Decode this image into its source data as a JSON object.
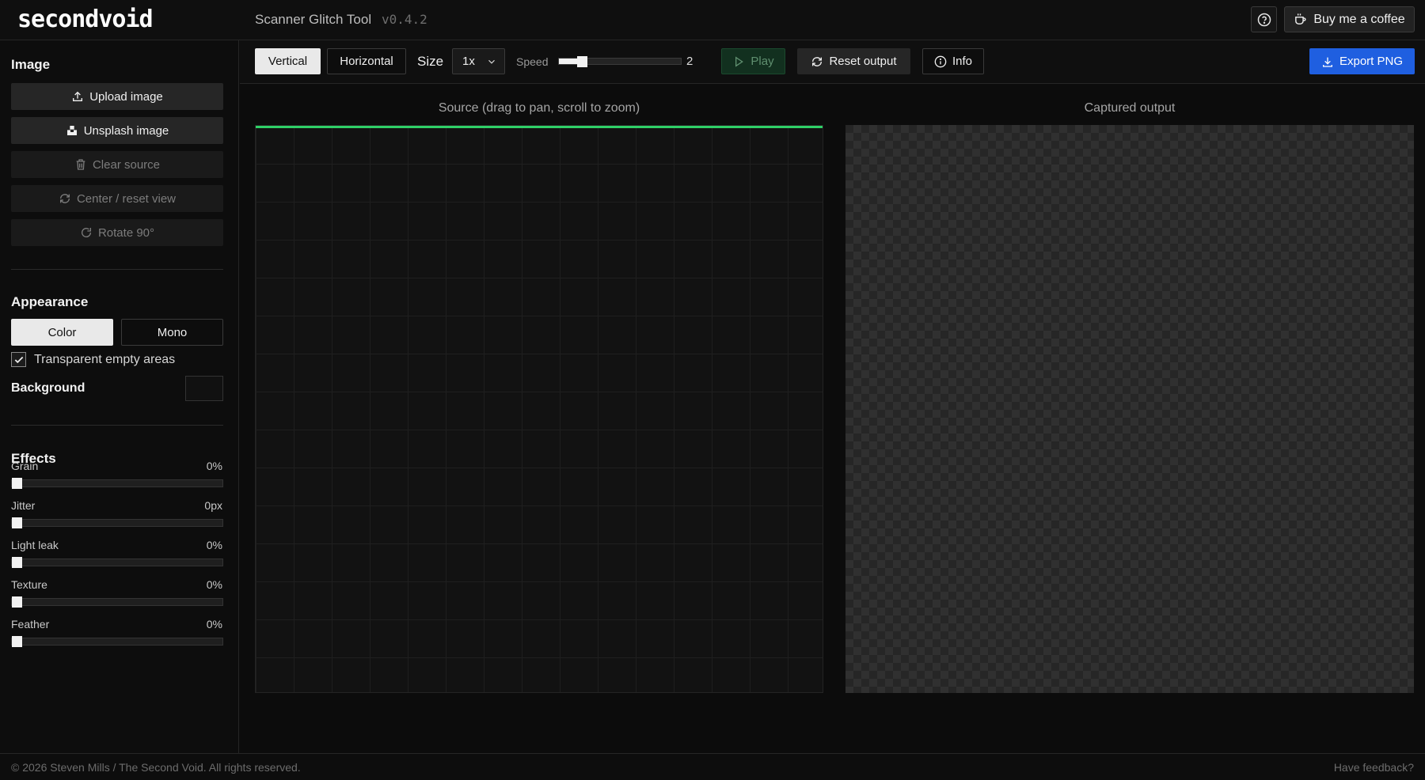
{
  "header": {
    "logo_text": "secondvoid",
    "title": "Scanner Glitch Tool",
    "version": "v0.4.2",
    "help_icon": "help-circle-icon",
    "coffee_label": "Buy me a coffee",
    "coffee_icon": "coffee-cup-icon"
  },
  "sidebar": {
    "image_title": "Image",
    "buttons": [
      {
        "label": "Upload image",
        "icon": "upload-icon",
        "enabled": true
      },
      {
        "label": "Unsplash image",
        "icon": "unsplash-icon",
        "enabled": true
      },
      {
        "label": "Clear source",
        "icon": "trash-icon",
        "enabled": false
      },
      {
        "label": "Center / reset view",
        "icon": "refresh-icon",
        "enabled": false
      },
      {
        "label": "Rotate 90°",
        "icon": "rotate-icon",
        "enabled": false
      }
    ],
    "appearance_title": "Appearance",
    "appearance_options": [
      "Color",
      "Mono"
    ],
    "appearance_selected": "Color",
    "transparent_label": "Transparent empty areas",
    "transparent_checked": true,
    "background_label": "Background",
    "background_color": "#111111",
    "effects_title": "Effects",
    "effects": [
      {
        "label": "Grain",
        "value": "0%",
        "level": 0
      },
      {
        "label": "Jitter",
        "value": "0px",
        "level": 0
      },
      {
        "label": "Light leak",
        "value": "0%",
        "level": 0
      },
      {
        "label": "Texture",
        "value": "0%",
        "level": 0
      },
      {
        "label": "Feather",
        "value": "0%",
        "level": 0
      }
    ]
  },
  "toolbar": {
    "direction_options": [
      "Vertical",
      "Horizontal"
    ],
    "direction_selected": "Vertical",
    "size_label": "Size",
    "size_value": "1x",
    "speed_label": "Speed",
    "speed_value": "2",
    "speed_level": 0.15,
    "play_label": "Play",
    "reset_label": "Reset output",
    "info_label": "Info",
    "export_label": "Export PNG"
  },
  "main": {
    "source_title": "Source (drag to pan, scroll to zoom)",
    "output_title": "Captured output"
  },
  "footer": {
    "copyright": "© 2026 Steven Mills / The Second Void. All rights reserved.",
    "feedback": "Have feedback?"
  },
  "colors": {
    "accent_blue": "#1f5fe0",
    "scan_line_green": "#2fd067",
    "play_green": "#12301f"
  }
}
